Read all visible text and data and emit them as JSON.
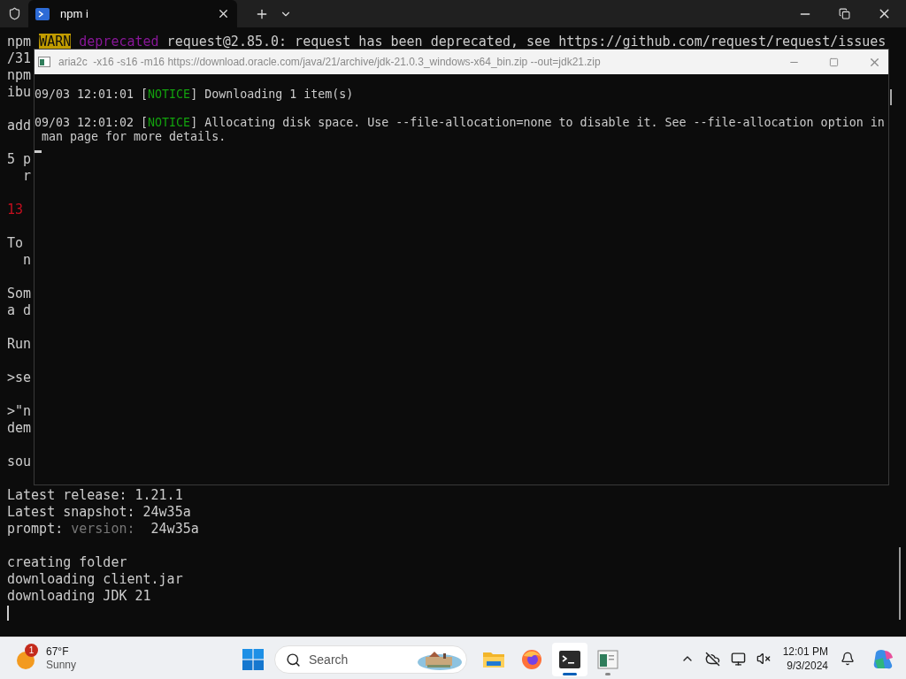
{
  "terminal": {
    "tab": {
      "title": "npm i",
      "selected": true
    },
    "lines": [
      {
        "kind": "text",
        "segments": [
          {
            "text": "npm ",
            "kind": "plain"
          },
          {
            "text": "WARN",
            "kind": "warn"
          },
          {
            "text": " deprecated",
            "kind": "deprecated"
          },
          {
            "text": " request@2.85.0: request has been deprecated, see https://github.com/request/request/issues",
            "kind": "plain"
          }
        ]
      },
      {
        "kind": "text",
        "segments": [
          {
            "text": "/31",
            "kind": "plain"
          }
        ]
      },
      {
        "kind": "text",
        "segments": [
          {
            "text": "npm",
            "kind": "plain"
          }
        ]
      },
      {
        "kind": "text",
        "segments": [
          {
            "text": "ibu",
            "kind": "plain"
          }
        ]
      },
      {
        "kind": "blank"
      },
      {
        "kind": "text",
        "segments": [
          {
            "text": "add",
            "kind": "plain"
          }
        ]
      },
      {
        "kind": "blank"
      },
      {
        "kind": "text",
        "segments": [
          {
            "text": "5 p",
            "kind": "plain"
          }
        ]
      },
      {
        "kind": "text",
        "segments": [
          {
            "text": "  r",
            "kind": "plain"
          }
        ]
      },
      {
        "kind": "blank"
      },
      {
        "kind": "text",
        "segments": [
          {
            "text": "13",
            "kind": "error"
          }
        ]
      },
      {
        "kind": "blank"
      },
      {
        "kind": "text",
        "segments": [
          {
            "text": "To",
            "kind": "plain"
          }
        ]
      },
      {
        "kind": "text",
        "segments": [
          {
            "text": "  n",
            "kind": "plain"
          }
        ]
      },
      {
        "kind": "blank"
      },
      {
        "kind": "text",
        "segments": [
          {
            "text": "Som",
            "kind": "plain"
          }
        ]
      },
      {
        "kind": "text",
        "segments": [
          {
            "text": "a d",
            "kind": "plain"
          }
        ]
      },
      {
        "kind": "blank"
      },
      {
        "kind": "text",
        "segments": [
          {
            "text": "Run",
            "kind": "plain"
          }
        ]
      },
      {
        "kind": "blank"
      },
      {
        "kind": "text",
        "segments": [
          {
            "text": ">se",
            "kind": "plain"
          }
        ]
      },
      {
        "kind": "blank"
      },
      {
        "kind": "text",
        "segments": [
          {
            "text": ">\"n",
            "kind": "plain"
          }
        ]
      },
      {
        "kind": "text",
        "segments": [
          {
            "text": "dem",
            "kind": "plain"
          }
        ]
      },
      {
        "kind": "blank"
      },
      {
        "kind": "text",
        "segments": [
          {
            "text": "sou",
            "kind": "plain"
          }
        ]
      },
      {
        "kind": "blank"
      },
      {
        "kind": "text",
        "segments": [
          {
            "text": "Latest release: 1.21.1",
            "kind": "plain"
          }
        ]
      },
      {
        "kind": "text",
        "segments": [
          {
            "text": "Latest snapshot: 24w35a",
            "kind": "plain"
          }
        ]
      },
      {
        "kind": "text",
        "segments": [
          {
            "text": "prompt: ",
            "kind": "plain"
          },
          {
            "text": "version: ",
            "kind": "dim"
          },
          {
            "text": " 24w35a",
            "kind": "plain"
          }
        ]
      },
      {
        "kind": "blank"
      },
      {
        "kind": "text",
        "segments": [
          {
            "text": "creating folder",
            "kind": "plain"
          }
        ]
      },
      {
        "kind": "text",
        "segments": [
          {
            "text": "downloading client.jar",
            "kind": "plain"
          }
        ]
      },
      {
        "kind": "text",
        "segments": [
          {
            "text": "downloading JDK 21",
            "kind": "plain"
          }
        ]
      },
      {
        "kind": "cursor"
      }
    ]
  },
  "console": {
    "title": "aria2c  -x16 -s16 -m16 https://download.oracle.com/java/21/archive/jdk-21.0.3_windows-x64_bin.zip --out=jdk21.zip",
    "lines": [
      {
        "kind": "text",
        "segments": [
          {
            "text": "09/03 12:01:01 [",
            "kind": "plain"
          },
          {
            "text": "NOTICE",
            "kind": "notice"
          },
          {
            "text": "] Downloading 1 item(s)",
            "kind": "plain"
          }
        ]
      },
      {
        "kind": "blank"
      },
      {
        "kind": "text",
        "segments": [
          {
            "text": "09/03 12:01:02 [",
            "kind": "plain"
          },
          {
            "text": "NOTICE",
            "kind": "notice"
          },
          {
            "text": "] Allocating disk space. Use --file-allocation=none to disable it. See --file-allocation option in",
            "kind": "plain"
          }
        ]
      },
      {
        "kind": "text",
        "segments": [
          {
            "text": " man page for more details.",
            "kind": "plain"
          }
        ]
      },
      {
        "kind": "cursor"
      }
    ]
  },
  "taskbar": {
    "weather": {
      "badge": "1",
      "temperature": "67°F",
      "condition": "Sunny"
    },
    "search": {
      "placeholder": "Search"
    },
    "apps": [
      {
        "kind": "explorer",
        "active": false,
        "running": false
      },
      {
        "kind": "browser",
        "active": false,
        "running": false
      },
      {
        "kind": "terminal",
        "active": true,
        "running": true
      },
      {
        "kind": "console",
        "active": false,
        "running": true
      }
    ],
    "time": "12:01 PM",
    "date": "9/3/2024"
  }
}
